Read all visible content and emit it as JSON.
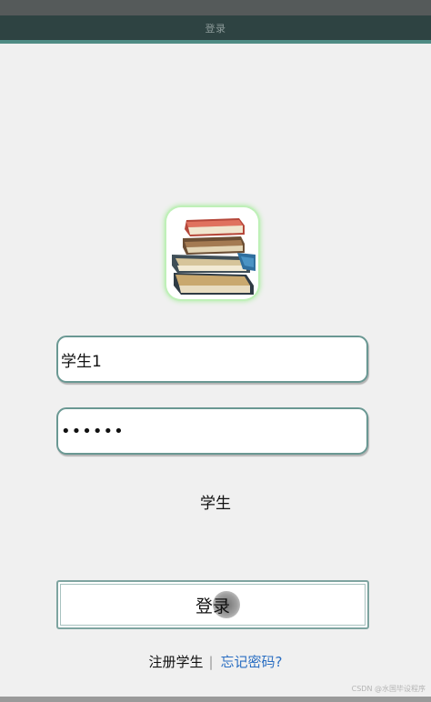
{
  "window": {
    "title": "登录"
  },
  "form": {
    "username_value": "学生1",
    "password_masked": "••••••",
    "role_label": "学生",
    "login_label": "登录"
  },
  "links": {
    "register": "注册学生",
    "separator": "|",
    "forgot_password": "忘记密码?"
  },
  "watermark": {
    "text": "CSDN @水国毕设程序"
  },
  "icons": {
    "app_icon": "books-icon"
  },
  "colors": {
    "title_bar": "#2e4342",
    "accent_line": "#4f8b84",
    "field_border": "#6a9893",
    "link_blue": "#2a6ec2",
    "icon_glow": "#a6ec9c"
  }
}
